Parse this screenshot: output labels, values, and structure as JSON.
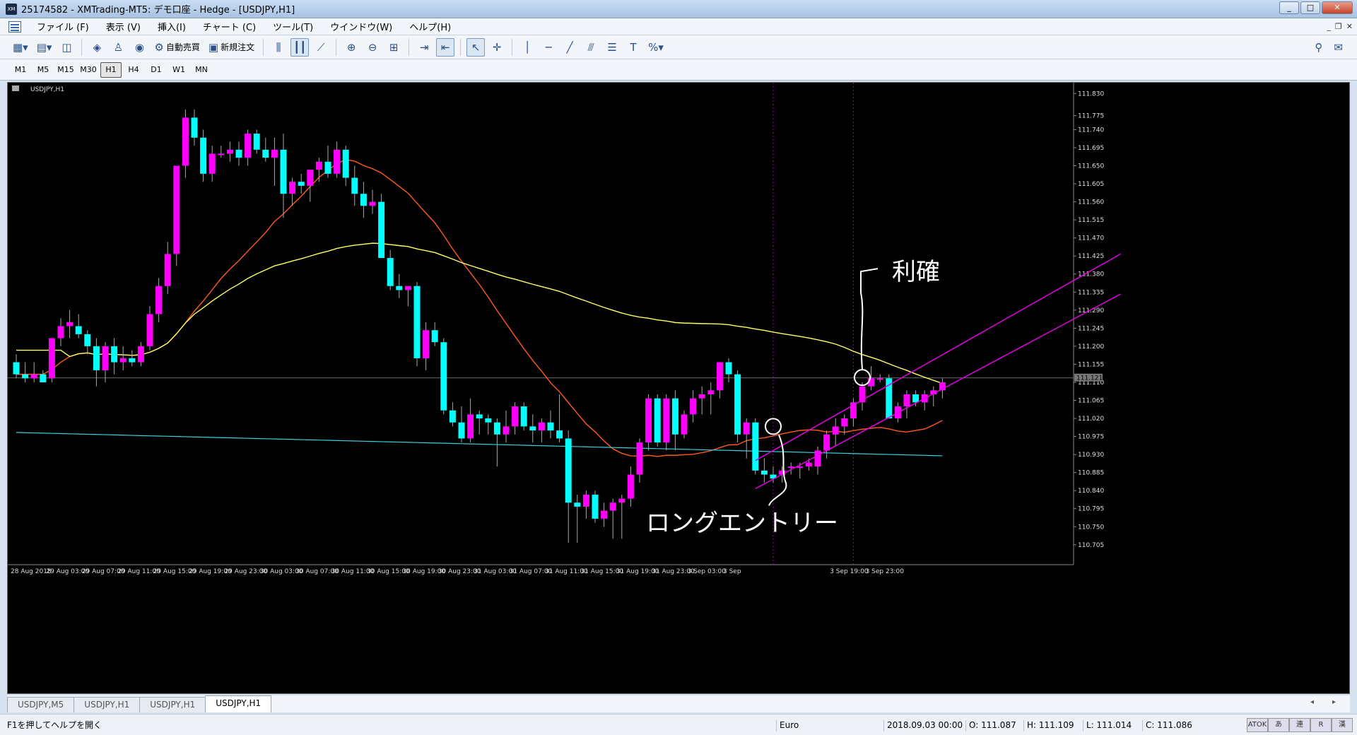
{
  "window": {
    "title": "25174582 - XMTrading-MT5: デモ口座 - Hedge - [USDJPY,H1]",
    "app_icon": "XM"
  },
  "menu": [
    "ファイル (F)",
    "表示 (V)",
    "挿入(I)",
    "チャート (C)",
    "ツール(T)",
    "ウインドウ(W)",
    "ヘルプ(H)"
  ],
  "toolbar": {
    "auto_trade": "自動売買",
    "new_order": "新規注文"
  },
  "timeframes": [
    "M1",
    "M5",
    "M15",
    "M30",
    "H1",
    "H4",
    "D1",
    "W1",
    "MN"
  ],
  "active_timeframe": "H1",
  "chart": {
    "symbol_label": "USDJPY,H1",
    "current_price_label": "111.121",
    "annotation_entry": "ロングエントリー",
    "annotation_profit": "利確",
    "colors": {
      "bull": "#ff00ff",
      "bear": "#00ffff",
      "ma_fast": "#ff5a1e",
      "ma_mid": "#ffff66",
      "ma_slow": "#3ccfe0",
      "channel": "#e600e6",
      "grid": "#8a8a8a"
    }
  },
  "chart_data": {
    "type": "candlestick",
    "symbol": "USDJPY",
    "timeframe": "H1",
    "y_ticks": [
      "111.830",
      "111.775",
      "111.740",
      "111.695",
      "111.650",
      "111.605",
      "111.560",
      "111.515",
      "111.470",
      "111.425",
      "111.380",
      "111.335",
      "111.290",
      "111.245",
      "111.200",
      "111.155",
      "111.110",
      "111.065",
      "111.020",
      "110.975",
      "110.930",
      "110.885",
      "110.840",
      "110.795",
      "110.750",
      "110.705"
    ],
    "x_ticks": [
      "28 Aug 2018",
      "29 Aug 03:00",
      "29 Aug 07:00",
      "29 Aug 11:00",
      "29 Aug 15:00",
      "29 Aug 19:00",
      "29 Aug 23:00",
      "30 Aug 03:00",
      "30 Aug 07:00",
      "30 Aug 11:00",
      "30 Aug 15:00",
      "30 Aug 19:00",
      "30 Aug 23:00",
      "31 Aug 03:00",
      "31 Aug 07:00",
      "31 Aug 11:00",
      "31 Aug 15:00",
      "31 Aug 19:00",
      "31 Aug 23:00",
      "3 Sep 03:00",
      "3 Sep",
      "3 Sep 19:00",
      "3 Sep 23:00"
    ],
    "ylim": [
      110.68,
      111.85
    ],
    "current_price": 111.121,
    "candles": [
      [
        111.16,
        111.18,
        111.12,
        111.13
      ],
      [
        111.13,
        111.16,
        111.11,
        111.12
      ],
      [
        111.12,
        111.16,
        111.11,
        111.13
      ],
      [
        111.13,
        111.14,
        111.11,
        111.11
      ],
      [
        111.12,
        111.22,
        111.11,
        111.22
      ],
      [
        111.22,
        111.27,
        111.2,
        111.25
      ],
      [
        111.25,
        111.29,
        111.22,
        111.26
      ],
      [
        111.25,
        111.28,
        111.22,
        111.23
      ],
      [
        111.23,
        111.24,
        111.18,
        111.2
      ],
      [
        111.2,
        111.22,
        111.1,
        111.14
      ],
      [
        111.14,
        111.21,
        111.11,
        111.2
      ],
      [
        111.2,
        111.22,
        111.13,
        111.16
      ],
      [
        111.16,
        111.2,
        111.14,
        111.17
      ],
      [
        111.17,
        111.19,
        111.15,
        111.16
      ],
      [
        111.16,
        111.21,
        111.15,
        111.2
      ],
      [
        111.2,
        111.3,
        111.19,
        111.28
      ],
      [
        111.28,
        111.37,
        111.26,
        111.35
      ],
      [
        111.35,
        111.46,
        111.33,
        111.43
      ],
      [
        111.43,
        111.65,
        111.4,
        111.65
      ],
      [
        111.65,
        111.79,
        111.62,
        111.77
      ],
      [
        111.77,
        111.79,
        111.7,
        111.72
      ],
      [
        111.72,
        111.74,
        111.61,
        111.63
      ],
      [
        111.63,
        111.7,
        111.61,
        111.68
      ],
      [
        111.68,
        111.7,
        111.67,
        111.68
      ],
      [
        111.68,
        111.71,
        111.66,
        111.69
      ],
      [
        111.69,
        111.71,
        111.65,
        111.67
      ],
      [
        111.67,
        111.74,
        111.65,
        111.73
      ],
      [
        111.73,
        111.74,
        111.68,
        111.69
      ],
      [
        111.69,
        111.72,
        111.66,
        111.67
      ],
      [
        111.67,
        111.72,
        111.6,
        111.69
      ],
      [
        111.69,
        111.73,
        111.52,
        111.58
      ],
      [
        111.58,
        111.62,
        111.55,
        111.61
      ],
      [
        111.61,
        111.63,
        111.58,
        111.6
      ],
      [
        111.6,
        111.63,
        111.56,
        111.64
      ],
      [
        111.64,
        111.67,
        111.61,
        111.66
      ],
      [
        111.66,
        111.7,
        111.62,
        111.63
      ],
      [
        111.63,
        111.71,
        111.62,
        111.69
      ],
      [
        111.69,
        111.7,
        111.6,
        111.62
      ],
      [
        111.62,
        111.65,
        111.55,
        111.58
      ],
      [
        111.58,
        111.61,
        111.52,
        111.55
      ],
      [
        111.55,
        111.59,
        111.53,
        111.56
      ],
      [
        111.56,
        111.58,
        111.45,
        111.42
      ],
      [
        111.42,
        111.44,
        111.34,
        111.35
      ],
      [
        111.35,
        111.38,
        111.32,
        111.34
      ],
      [
        111.34,
        111.35,
        111.3,
        111.35
      ],
      [
        111.35,
        111.36,
        111.15,
        111.17
      ],
      [
        111.17,
        111.26,
        111.14,
        111.24
      ],
      [
        111.24,
        111.26,
        111.2,
        111.21
      ],
      [
        111.21,
        111.22,
        111.03,
        111.04
      ],
      [
        111.04,
        111.06,
        111.0,
        111.01
      ],
      [
        111.01,
        111.05,
        110.96,
        110.97
      ],
      [
        110.97,
        111.07,
        110.96,
        111.03
      ],
      [
        111.03,
        111.04,
        110.98,
        111.02
      ],
      [
        111.02,
        111.03,
        110.98,
        111.01
      ],
      [
        111.01,
        111.02,
        110.9,
        110.98
      ],
      [
        110.98,
        111.04,
        110.96,
        111.0
      ],
      [
        111.0,
        111.06,
        110.98,
        111.05
      ],
      [
        111.05,
        111.06,
        110.99,
        111.0
      ],
      [
        111.0,
        111.03,
        110.96,
        110.99
      ],
      [
        110.99,
        111.02,
        110.96,
        111.01
      ],
      [
        111.01,
        111.04,
        110.97,
        110.99
      ],
      [
        110.99,
        111.08,
        110.96,
        110.97
      ],
      [
        110.97,
        110.99,
        110.71,
        110.81
      ],
      [
        110.81,
        110.83,
        110.71,
        110.8
      ],
      [
        110.8,
        110.84,
        110.77,
        110.83
      ],
      [
        110.83,
        110.84,
        110.76,
        110.77
      ],
      [
        110.77,
        110.81,
        110.75,
        110.79
      ],
      [
        110.79,
        110.82,
        110.72,
        110.81
      ],
      [
        110.81,
        110.83,
        110.72,
        110.82
      ],
      [
        110.82,
        110.9,
        110.8,
        110.88
      ],
      [
        110.88,
        110.97,
        110.86,
        110.96
      ],
      [
        110.96,
        111.08,
        110.94,
        111.07
      ],
      [
        111.07,
        111.08,
        110.95,
        110.96
      ],
      [
        110.96,
        111.08,
        110.94,
        111.07
      ],
      [
        111.07,
        111.09,
        110.94,
        110.98
      ],
      [
        110.98,
        111.04,
        110.97,
        111.03
      ],
      [
        111.03,
        111.09,
        111.01,
        111.07
      ],
      [
        111.07,
        111.1,
        111.03,
        111.08
      ],
      [
        111.08,
        111.11,
        111.03,
        111.09
      ],
      [
        111.09,
        111.16,
        111.07,
        111.16
      ],
      [
        111.16,
        111.17,
        111.11,
        111.13
      ],
      [
        111.13,
        111.14,
        110.96,
        110.98
      ],
      [
        110.98,
        111.02,
        110.92,
        111.01
      ],
      [
        111.01,
        111.02,
        110.88,
        110.89
      ],
      [
        110.89,
        110.92,
        110.86,
        110.88
      ],
      [
        110.88,
        110.9,
        110.86,
        110.87
      ],
      [
        110.88,
        110.9,
        110.86,
        110.89
      ],
      [
        110.9,
        110.91,
        110.88,
        110.9
      ],
      [
        110.9,
        110.91,
        110.87,
        110.9
      ],
      [
        110.9,
        110.92,
        110.89,
        110.91
      ],
      [
        110.9,
        110.95,
        110.88,
        110.94
      ],
      [
        110.94,
        110.99,
        110.92,
        110.98
      ],
      [
        110.98,
        111.02,
        110.95,
        111.0
      ],
      [
        111.0,
        111.03,
        110.98,
        111.02
      ],
      [
        111.02,
        111.07,
        111.0,
        111.06
      ],
      [
        111.06,
        111.11,
        111.04,
        111.1
      ],
      [
        111.1,
        111.15,
        111.09,
        111.12
      ],
      [
        111.12,
        111.13,
        111.11,
        111.12
      ],
      [
        111.12,
        111.13,
        111.06,
        111.02
      ],
      [
        111.02,
        111.06,
        111.01,
        111.05
      ],
      [
        111.05,
        111.09,
        111.02,
        111.08
      ],
      [
        111.08,
        111.09,
        111.05,
        111.06
      ],
      [
        111.06,
        111.09,
        111.04,
        111.08
      ],
      [
        111.08,
        111.1,
        111.05,
        111.09
      ],
      [
        111.09,
        111.12,
        111.07,
        111.11
      ]
    ],
    "annotations": [
      "ロングエントリー",
      "利確"
    ]
  },
  "tabs": [
    "USDJPY,M5",
    "USDJPY,H1",
    "USDJPY,H1",
    "USDJPY,H1"
  ],
  "active_tab": 3,
  "status": {
    "help": "F1を押してヘルプを開く",
    "profile": "Euro",
    "datetime": "2018.09.03 00:00",
    "open": "O: 111.087",
    "high": "H: 111.109",
    "low": "L: 111.014",
    "close": "C: 111.086",
    "ime": [
      "ATOK",
      "あ",
      "連",
      "R",
      "漢"
    ]
  }
}
